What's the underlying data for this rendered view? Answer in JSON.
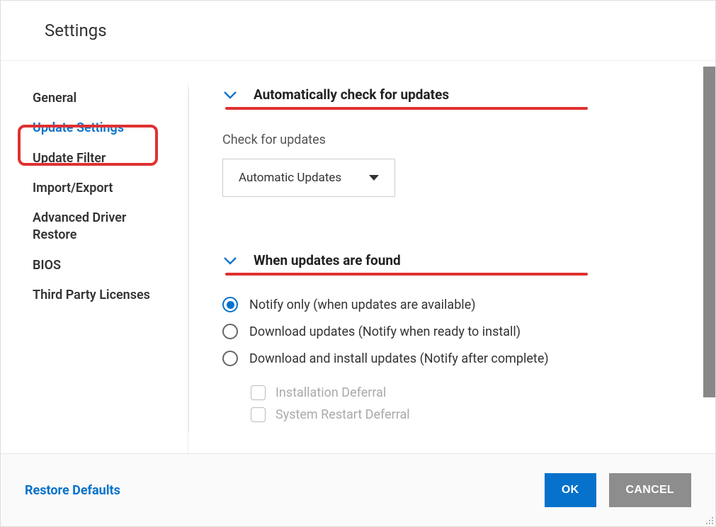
{
  "header": {
    "title": "Settings"
  },
  "sidebar": {
    "items": [
      {
        "label": "General"
      },
      {
        "label": "Update Settings"
      },
      {
        "label": "Update Filter"
      },
      {
        "label": "Import/Export"
      },
      {
        "label": "Advanced Driver Restore"
      },
      {
        "label": "BIOS"
      },
      {
        "label": "Third Party Licenses"
      }
    ],
    "active_index": 1
  },
  "section_auto": {
    "title": "Automatically check for updates",
    "field_label": "Check for updates",
    "select_value": "Automatic Updates"
  },
  "section_found": {
    "title": "When updates are found",
    "radios": [
      {
        "label": "Notify only (when updates are available)"
      },
      {
        "label": "Download updates (Notify when ready to install)"
      },
      {
        "label": "Download and install updates (Notify after complete)"
      }
    ],
    "selected_index": 0,
    "checkboxes": [
      {
        "label": "Installation Deferral"
      },
      {
        "label": "System Restart Deferral"
      }
    ]
  },
  "footer": {
    "restore_label": "Restore Defaults",
    "ok_label": "OK",
    "cancel_label": "CANCEL"
  }
}
